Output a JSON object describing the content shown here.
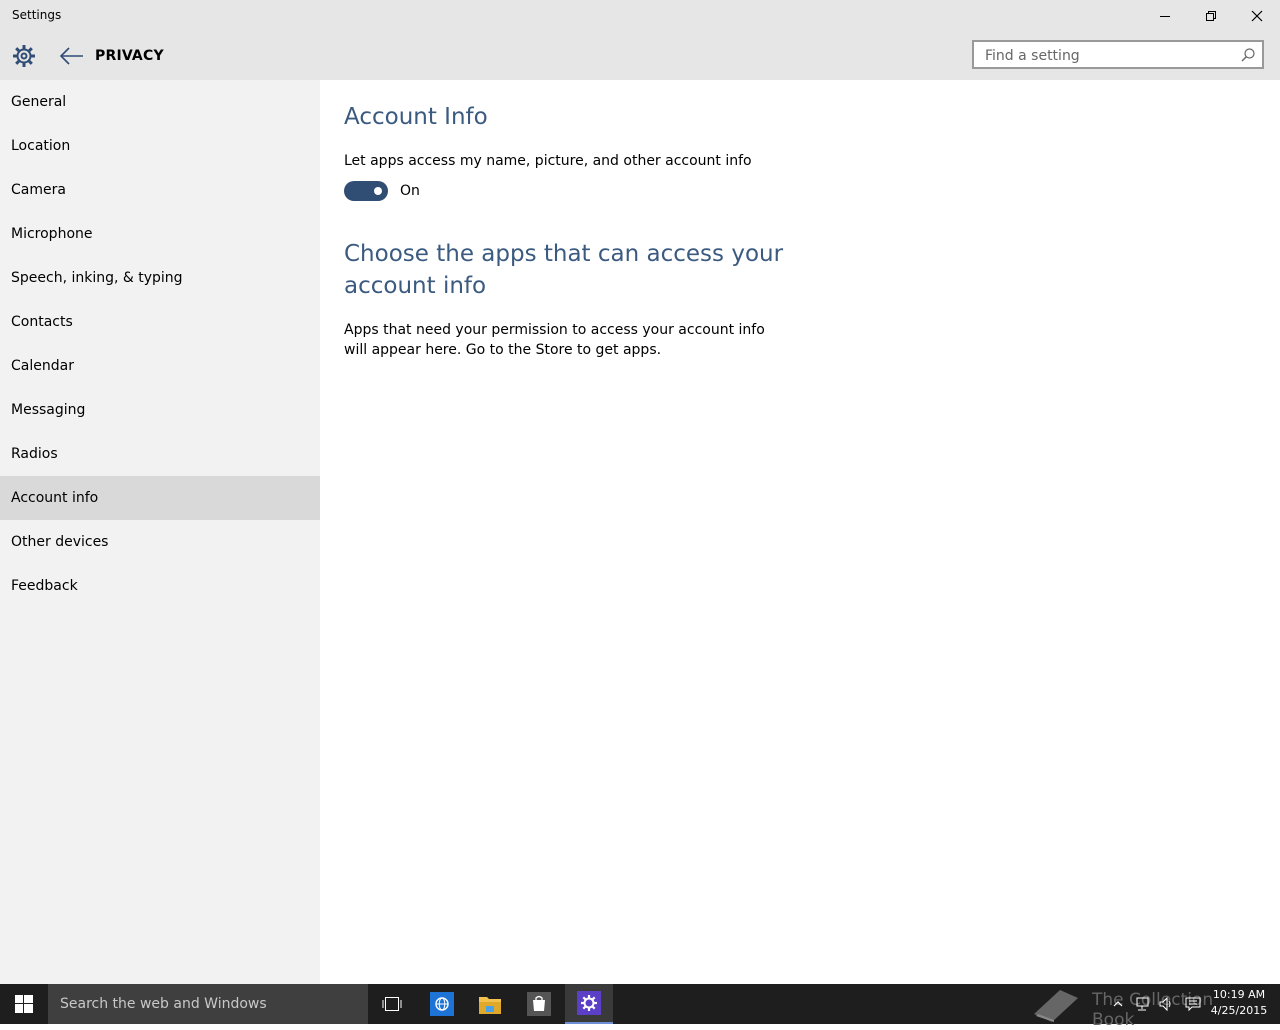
{
  "window": {
    "title": "Settings"
  },
  "header": {
    "section_title": "PRIVACY",
    "search_placeholder": "Find a setting"
  },
  "sidebar": {
    "items": [
      {
        "label": "General"
      },
      {
        "label": "Location"
      },
      {
        "label": "Camera"
      },
      {
        "label": "Microphone"
      },
      {
        "label": "Speech, inking, & typing"
      },
      {
        "label": "Contacts"
      },
      {
        "label": "Calendar"
      },
      {
        "label": "Messaging"
      },
      {
        "label": "Radios"
      },
      {
        "label": "Account info",
        "selected": true
      },
      {
        "label": "Other devices"
      },
      {
        "label": "Feedback"
      }
    ]
  },
  "main": {
    "heading": "Account Info",
    "toggle_description": "Let apps access my name, picture, and other account info",
    "toggle_state": "On",
    "toggle_on": true,
    "apps_heading": "Choose the apps that can access your account info",
    "apps_description": "Apps that need your permission to access your account info will appear here. Go to the Store to get apps."
  },
  "taskbar": {
    "search_placeholder": "Search the web and Windows",
    "watermark": "The Collection Book",
    "time": "10:19 AM",
    "date": "4/25/2015"
  },
  "colors": {
    "accent": "#304d74",
    "heading": "#3b5a80",
    "sidebar_bg": "#f2f2f2",
    "selected_bg": "#d9d9d9",
    "taskbar_bg": "#1e1e1e"
  },
  "icons": [
    "settings-gear-icon",
    "back-arrow-icon",
    "search-icon",
    "minimize-icon",
    "restore-icon",
    "close-icon",
    "windows-start-icon",
    "task-view-icon",
    "edge-browser-icon",
    "file-explorer-icon",
    "store-icon",
    "settings-app-icon",
    "network-icon",
    "volume-icon",
    "action-center-icon"
  ]
}
